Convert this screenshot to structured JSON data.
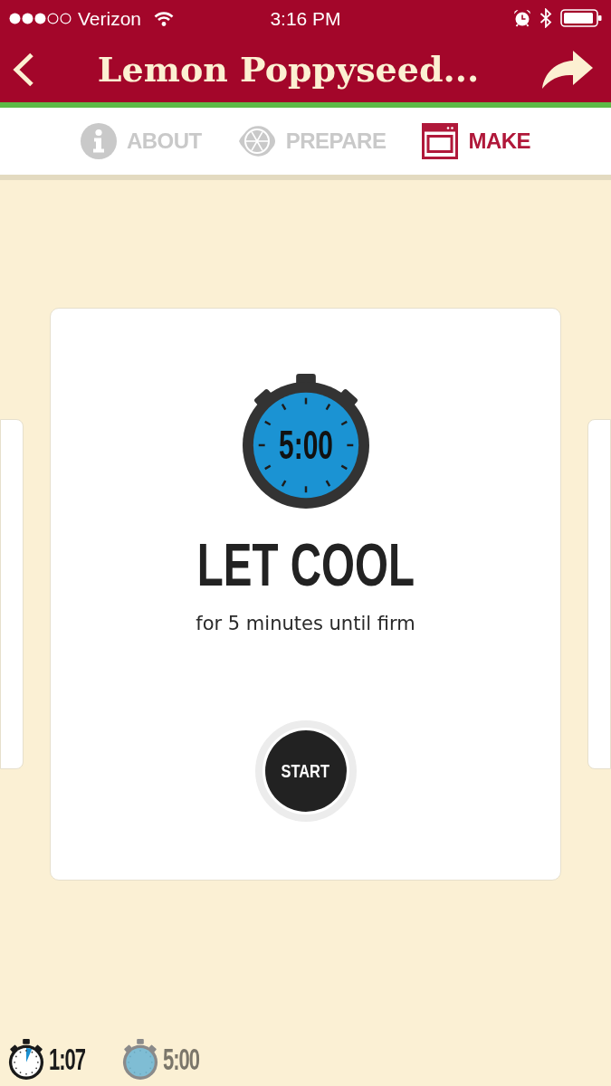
{
  "status_bar": {
    "carrier": "Verizon",
    "time": "3:16 PM"
  },
  "header": {
    "title": "Lemon Poppyseed..."
  },
  "tabs": [
    {
      "label": "ABOUT",
      "selected": false
    },
    {
      "label": "PREPARE",
      "selected": false
    },
    {
      "label": "MAKE",
      "selected": true
    }
  ],
  "step": {
    "timer": "5:00",
    "title": "LET COOL",
    "instruction": "for 5 minutes until firm",
    "button": "START"
  },
  "timers": [
    {
      "time": "1:07",
      "running": true
    },
    {
      "time": "5:00",
      "running": false
    }
  ]
}
